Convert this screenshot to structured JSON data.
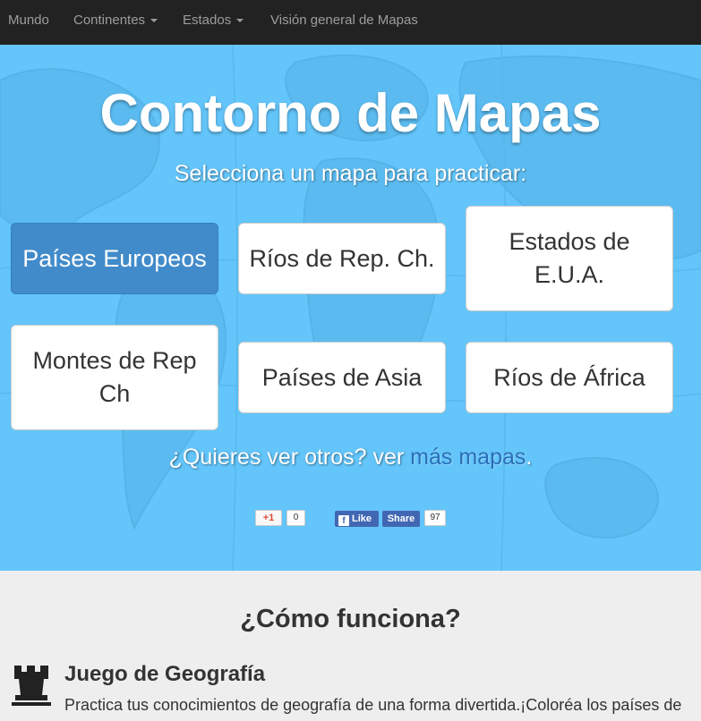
{
  "nav": {
    "items": [
      {
        "label": "Mundo"
      },
      {
        "label": "Continentes"
      },
      {
        "label": "Estados"
      },
      {
        "label": "Visión general de Mapas"
      }
    ]
  },
  "hero": {
    "title": "Contorno de Mapas",
    "subtitle": "Selecciona un mapa para practicar:",
    "maps": [
      {
        "label": "Países Europeos"
      },
      {
        "label": "Ríos de Rep. Ch."
      },
      {
        "label": "Estados de E.U.A."
      },
      {
        "label": "Montes de Rep Ch"
      },
      {
        "label": "Países de Asia"
      },
      {
        "label": "Ríos de África"
      }
    ],
    "more_prefix": "¿Quieres ver otros? ver ",
    "more_link": "más mapas",
    "more_suffix": "."
  },
  "social": {
    "gplus_label": "+1",
    "gplus_count": "0",
    "like_label": "Like",
    "share_label": "Share",
    "fb_count": "97"
  },
  "how": {
    "title": "¿Cómo funciona?",
    "feature_title": "Juego de Geografía",
    "feature_text": "Practica tus conocimientos de geografía de una forma divertida.¡Coloréa los países de"
  },
  "colors": {
    "navbar": "#222222",
    "hero": "#63c5fa",
    "primary_button": "#428bca",
    "facebook": "#4267b2",
    "link": "#2a6fb5"
  },
  "icons": {
    "feature": "rook-icon",
    "caret": "caret-down-icon",
    "facebook": "facebook-icon"
  }
}
